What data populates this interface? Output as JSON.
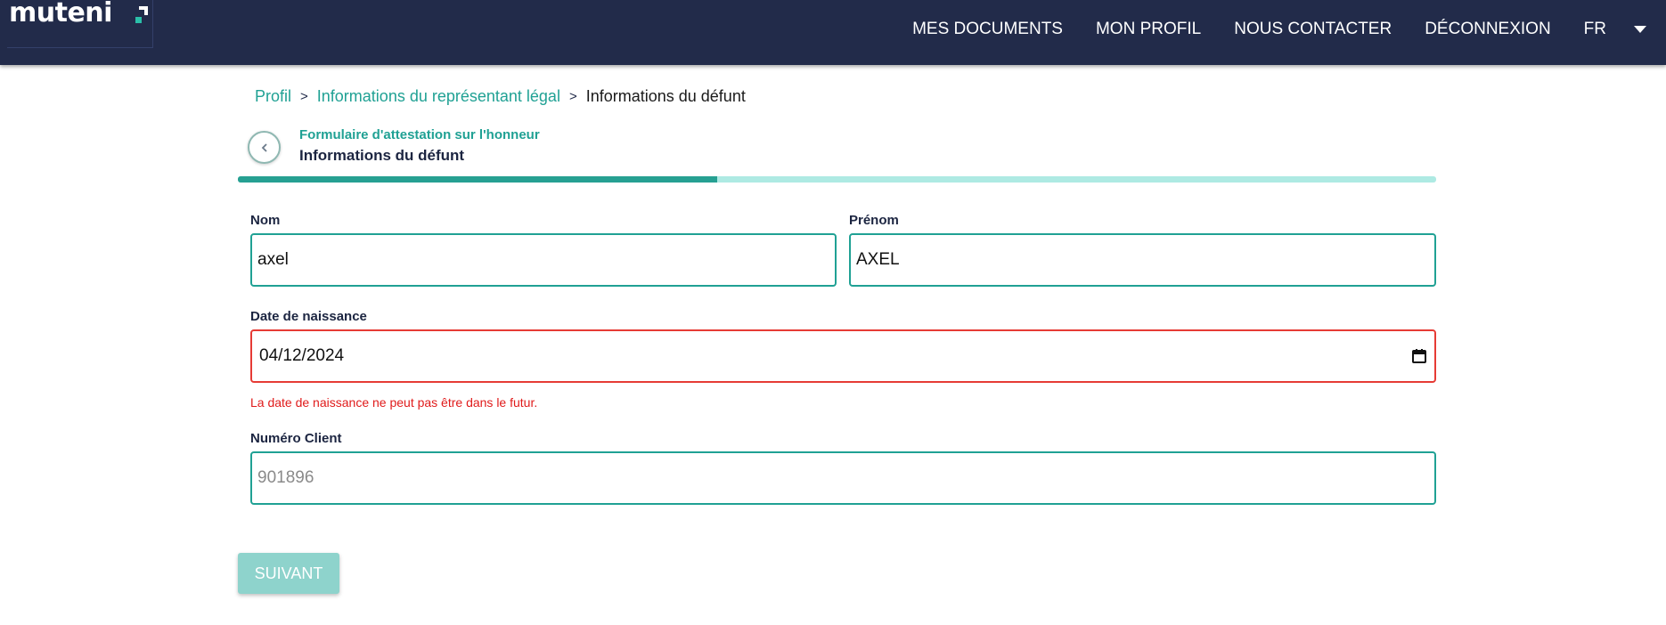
{
  "header": {
    "logo_text": "muteni",
    "nav": [
      "MES DOCUMENTS",
      "MON PROFIL",
      "NOUS CONTACTER",
      "DÉCONNEXION"
    ],
    "language": "FR",
    "brand_color": "#222b4a"
  },
  "breadcrumb": {
    "items": [
      "Profil",
      "Informations du représentant légal",
      "Informations du défunt"
    ]
  },
  "form": {
    "subtitle": "Formulaire d'attestation sur l'honneur",
    "title": "Informations du défunt",
    "progress": 0.4,
    "accent_color": "#20a194",
    "fields": {
      "nom": {
        "label": "Nom",
        "value": "axel"
      },
      "prenom": {
        "label": "Prénom",
        "value": "AXEL"
      },
      "date_naissance": {
        "label": "Date de naissance",
        "value": "04/12/2024",
        "error": "La date de naissance ne peut pas être dans le futur."
      },
      "numero_client": {
        "label": "Numéro Client",
        "value": "901896"
      }
    },
    "next_label": "SUIVANT"
  }
}
